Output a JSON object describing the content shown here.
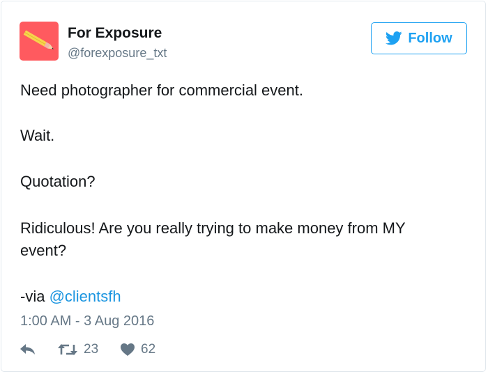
{
  "account": {
    "display_name": "For Exposure",
    "handle": "@forexposure_txt"
  },
  "follow_button": {
    "label": "Follow",
    "color": "#1da1f2"
  },
  "tweet": {
    "lines": [
      "Need photographer for commercial event.",
      "Wait.",
      "Quotation?",
      "Ridiculous! Are you really trying to make money from MY",
      "event?"
    ],
    "via_prefix": "-via ",
    "via_link": "@clientsfh",
    "timestamp": "1:00 AM - 3 Aug 2016"
  },
  "actions": {
    "reply_icon": "reply-icon",
    "retweet_icon": "retweet-icon",
    "retweet_count": "23",
    "like_icon": "heart-icon",
    "like_count": "62"
  },
  "colors": {
    "avatar_bg": "#ff5a5f",
    "link": "#1b95e0",
    "muted": "#657786"
  }
}
